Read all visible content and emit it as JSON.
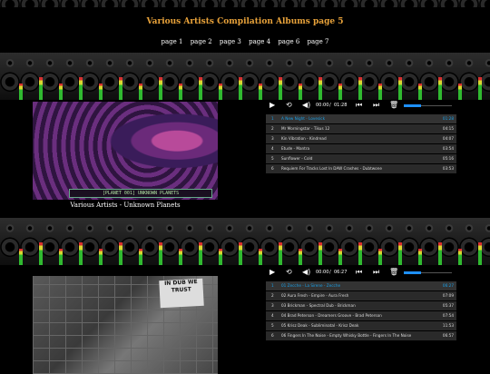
{
  "header": {
    "title": "Various Artists Compilation Albums page 5",
    "pages": [
      "page 1",
      "page 2",
      "page 3",
      "page 4",
      "page 6",
      "page 7"
    ]
  },
  "album1": {
    "caption": "Various Artists - Unknown Planets",
    "art_text": "[PLANET 001] UNKNOWN PLANETS",
    "player": {
      "current_time": "00:00",
      "total_time": "01:28",
      "progress": 0,
      "volume": 0.35
    },
    "tracks": [
      {
        "num": "1",
        "name": "A New Night - Lovesick",
        "duration": "01:28",
        "active": true
      },
      {
        "num": "2",
        "name": "Mr Morningstar - Tikus 12",
        "duration": "04:15",
        "active": false
      },
      {
        "num": "3",
        "name": "Kin Vibration - Kindread",
        "duration": "04:07",
        "active": false
      },
      {
        "num": "4",
        "name": "Etude - Mantra",
        "duration": "03:54",
        "active": false
      },
      {
        "num": "5",
        "name": "Sunflower - Cold",
        "duration": "05:16",
        "active": false
      },
      {
        "num": "6",
        "name": "Requiem For Tracks Lost In DAW Crashes - Dubtwone",
        "duration": "03:53",
        "active": false
      }
    ]
  },
  "album2": {
    "art_text": "IN DUB WE TRUST",
    "player": {
      "current_time": "00:00",
      "total_time": "06:27",
      "progress": 0,
      "volume": 0.35
    },
    "tracks": [
      {
        "num": "1",
        "name": "01 Zecche - La Sirene - Zecche",
        "duration": "06:27",
        "active": true
      },
      {
        "num": "2",
        "name": "02 Aura Fresh - Empire - Aura Fresh",
        "duration": "07:09",
        "active": false
      },
      {
        "num": "3",
        "name": "03 Brickman - Spectral Dub - Brickman",
        "duration": "05:37",
        "active": false
      },
      {
        "num": "4",
        "name": "04 Brad Peterson - Dreamers Groove - Brad Peterson",
        "duration": "07:54",
        "active": false
      },
      {
        "num": "5",
        "name": "05 Krisz Deak - Subliminatal - Krisz Deak",
        "duration": "11:53",
        "active": false
      },
      {
        "num": "6",
        "name": "06 Fingers In The Noise - Empty Whisky Bottle - Fingers In The Noise",
        "duration": "06:57",
        "active": false
      }
    ]
  },
  "icons": [
    "play-icon",
    "repeat-icon",
    "volume-icon",
    "previous-icon",
    "next-icon",
    "trash-icon"
  ],
  "colors": {
    "title": "#e8a23a",
    "active_track": "#19a0e8",
    "track_bg": "#2a2a2a",
    "background": "#000000"
  }
}
